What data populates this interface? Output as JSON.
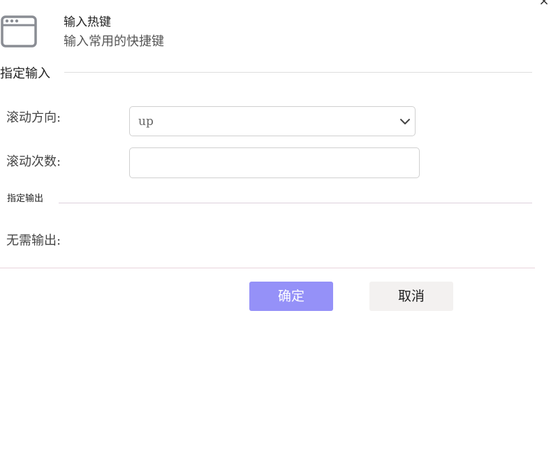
{
  "dialog": {
    "close_glyph": "×",
    "header": {
      "icon": "browser-window-icon",
      "title": "输入热键",
      "subtitle": "输入常用的快捷键"
    }
  },
  "input_section": {
    "title": "指定输入",
    "scroll_direction": {
      "label": "滚动方向:",
      "value": "up",
      "icon": "chevron-down-icon"
    },
    "scroll_count": {
      "label": "滚动次数:",
      "value": ""
    }
  },
  "output_section": {
    "title": "指定输出",
    "no_output_label": "无需输出:"
  },
  "footer": {
    "confirm_label": "确定",
    "cancel_label": "取消"
  },
  "colors": {
    "confirm_button": "#9591f8",
    "cancel_button": "#f3f1f0",
    "icon_gray": "#8a8d94"
  }
}
